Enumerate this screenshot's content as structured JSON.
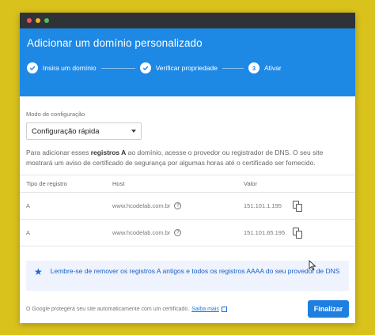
{
  "window": {
    "dots": [
      "#ee5a5a",
      "#f0b429",
      "#4cc35b"
    ]
  },
  "header": {
    "title": "Adicionar um domínio personalizado",
    "steps": [
      {
        "index": "",
        "label": "Insira um domínio",
        "state": "done"
      },
      {
        "index": "",
        "label": "Verificar propriedade",
        "state": "done"
      },
      {
        "index": "3",
        "label": "Ativar",
        "state": "current"
      }
    ]
  },
  "mode": {
    "label": "Modo de configuração",
    "selected": "Configuração rápida"
  },
  "description": {
    "before": "Para adicionar esses ",
    "bold": "registros A",
    "after": " ao domínio, acesse o provedor ou registrador de DNS. O seu site mostrará um aviso de certificado de segurança por algumas horas até o certificado ser fornecido."
  },
  "table": {
    "headers": [
      "Tipo de registro",
      "Host",
      "Valor"
    ],
    "rows": [
      {
        "type": "A",
        "host": "www.hcodelab.com.br",
        "value": "151.101.1.195"
      },
      {
        "type": "A",
        "host": "www.hcodelab.com.br",
        "value": "151.101.65.195"
      }
    ]
  },
  "banner": {
    "text": "Lembre-se de remover os registros A antigos e todos os registros AAAA do seu provedor de DNS"
  },
  "footer": {
    "text": "O Google protegerá seu site automaticamente com um certificado.",
    "link": "Saiba mais",
    "button": "Finalizar"
  },
  "colors": {
    "accent": "#1e88e5",
    "background": "#d9c21c",
    "banner_bg": "#eef3fd",
    "banner_text": "#1a5fc5"
  }
}
